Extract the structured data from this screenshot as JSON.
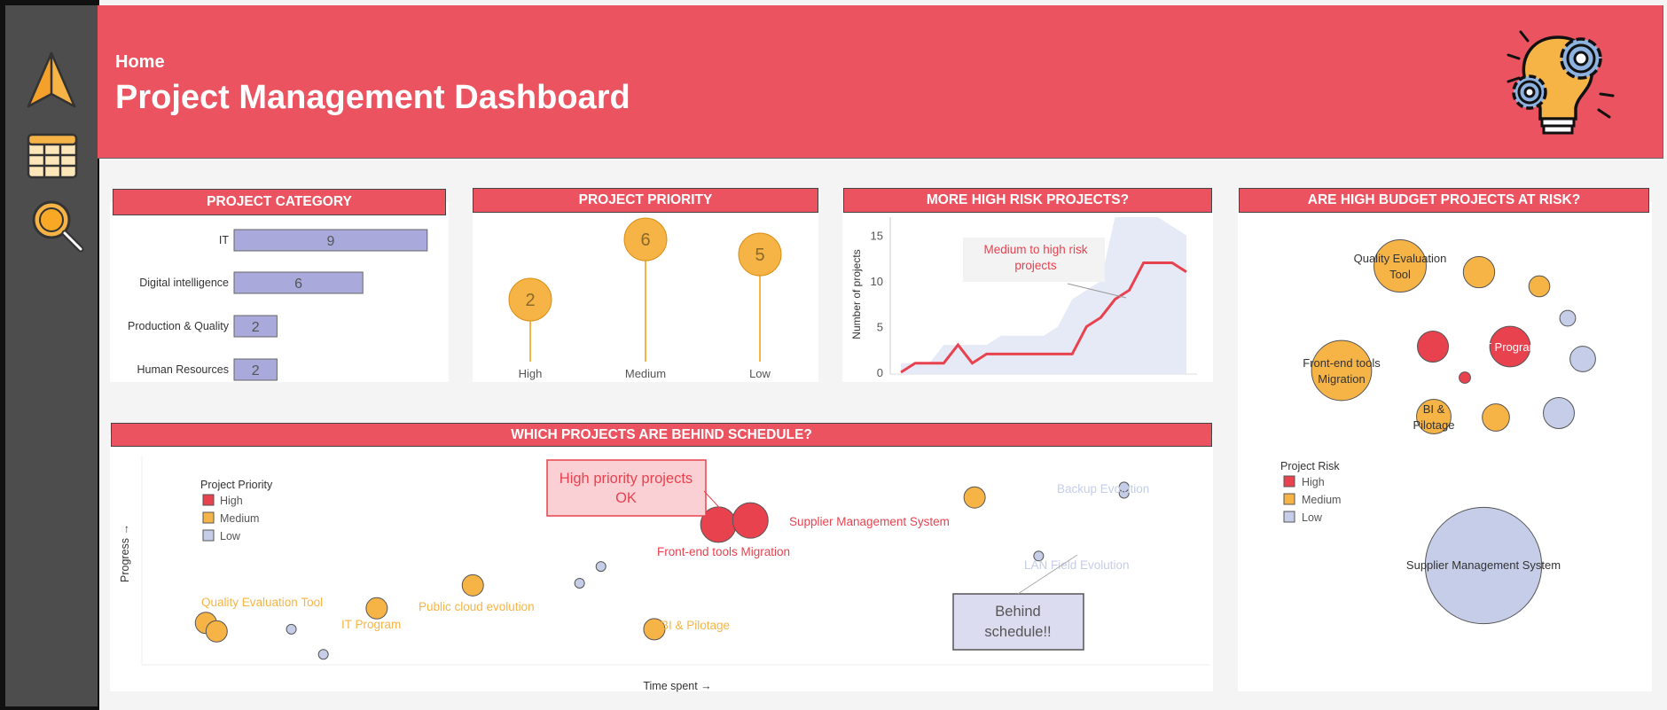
{
  "header": {
    "breadcrumb": "Home",
    "title": "Project Management Dashboard",
    "background": "#ea535f"
  },
  "sidebar": {
    "items": [
      {
        "icon": "navigation-arrow-icon"
      },
      {
        "icon": "table-grid-icon"
      },
      {
        "icon": "search-magnifier-icon"
      }
    ]
  },
  "colors": {
    "high": "#e8424f",
    "medium": "#f7b446",
    "low": "#c5cde8",
    "bar": "#a9aadb",
    "accent": "#ea535f"
  },
  "panels": {
    "category": {
      "title": "PROJECT CATEGORY",
      "chart_data": {
        "type": "bar",
        "categories": [
          "IT",
          "Digital intelligence",
          "Production & Quality",
          "Human Resources"
        ],
        "values": [
          9,
          6,
          2,
          2
        ]
      }
    },
    "priority": {
      "title": "PROJECT PRIORITY",
      "chart_data": {
        "type": "lollipop",
        "categories": [
          "High",
          "Medium",
          "Low"
        ],
        "values": [
          2,
          6,
          5
        ]
      }
    },
    "risk": {
      "title": "MORE HIGH RISK PROJECTS?",
      "annotation": "Medium to high risk projects",
      "ylabel": "Number of projects",
      "chart_data": {
        "type": "line",
        "ylim": [
          0,
          17
        ],
        "yticks": [
          0,
          5,
          10,
          15
        ],
        "series": [
          {
            "values": [
              0,
              1,
              1,
              1,
              3,
              1,
              2,
              2,
              2,
              2,
              2,
              2,
              2,
              5,
              6,
              8,
              9,
              12,
              12,
              12,
              11
            ],
            "color": "#e8424f"
          },
          {
            "values": [
              1,
              1,
              1,
              3,
              3,
              3,
              3,
              4,
              4,
              4,
              4,
              5,
              8,
              9,
              10,
              17,
              17,
              17,
              17,
              16,
              15
            ],
            "color": "#e6e9f6"
          }
        ]
      }
    },
    "budget": {
      "title": "ARE HIGH BUDGET PROJECTS AT RISK?",
      "legend_title": "Project Risk",
      "legend": [
        "High",
        "Medium",
        "Low"
      ],
      "labels": {
        "qe": "Quality Evaluation Tool",
        "fe": "Front-end tools Migration",
        "it": "IT Program",
        "bi": "BI & Pilotage",
        "sms": "Supplier Management System"
      },
      "chart_data": {
        "type": "bubble",
        "bubbles": [
          {
            "name": "Quality Evaluation Tool",
            "risk": "Medium",
            "size": 2730
          },
          {
            "name": "Front-end tools Migration",
            "risk": "Medium",
            "size": 3600
          },
          {
            "name": "IT Program",
            "risk": "High",
            "size": 1640
          },
          {
            "name": "BI & Pilotage",
            "risk": "Medium",
            "size": 1190
          },
          {
            "name": "Supplier Management System",
            "risk": "Low",
            "size": 13540
          },
          {
            "name": "",
            "risk": "Medium",
            "size": 980
          },
          {
            "name": "",
            "risk": "Medium",
            "size": 440
          },
          {
            "name": "",
            "risk": "Low",
            "size": 250
          },
          {
            "name": "",
            "risk": "Low",
            "size": 650
          },
          {
            "name": "",
            "risk": "High",
            "size": 960
          },
          {
            "name": "",
            "risk": "High",
            "size": 130
          },
          {
            "name": "",
            "risk": "Medium",
            "size": 740
          },
          {
            "name": "",
            "risk": "Low",
            "size": 960
          }
        ]
      }
    },
    "schedule": {
      "title": "WHICH PROJECTS ARE BEHIND SCHEDULE?",
      "legend_title": "Project Priority",
      "legend": [
        "High",
        "Medium",
        "Low"
      ],
      "xlabel": "Time spent →",
      "ylabel": "Progress →",
      "callout_high": "High priority projects OK",
      "callout_behind": "Behind schedule!!",
      "labels": {
        "qe": "Quality Evaluation Tool",
        "it": "IT Program",
        "pc": "Public cloud evolution",
        "bi": "BI & Pilotage",
        "fe": "Front-end tools Migration",
        "sms": "Supplier Management System",
        "backup": "Backup Evolution",
        "lan": "LAN Field Evolution"
      },
      "chart_data": {
        "type": "scatter",
        "points": [
          {
            "name": "Quality Evaluation Tool",
            "priority": "Medium",
            "x": 0.06,
            "y": 0.2
          },
          {
            "name": "",
            "priority": "Medium",
            "x": 0.07,
            "y": 0.16
          },
          {
            "name": "",
            "priority": "Low",
            "x": 0.14,
            "y": 0.17
          },
          {
            "name": "",
            "priority": "Low",
            "x": 0.17,
            "y": 0.05
          },
          {
            "name": "IT Program",
            "priority": "Medium",
            "x": 0.22,
            "y": 0.27
          },
          {
            "name": "Public cloud evolution",
            "priority": "Medium",
            "x": 0.31,
            "y": 0.38
          },
          {
            "name": "",
            "priority": "Low",
            "x": 0.41,
            "y": 0.39
          },
          {
            "name": "",
            "priority": "Low",
            "x": 0.43,
            "y": 0.47
          },
          {
            "name": "BI & Pilotage",
            "priority": "Medium",
            "x": 0.48,
            "y": 0.17
          },
          {
            "name": "Front-end tools Migration",
            "priority": "High",
            "x": 0.54,
            "y": 0.67
          },
          {
            "name": "Supplier Management System",
            "priority": "High",
            "x": 0.57,
            "y": 0.69
          },
          {
            "name": "",
            "priority": "Medium",
            "x": 0.78,
            "y": 0.8
          },
          {
            "name": "LAN Field Evolution",
            "priority": "Low",
            "x": 0.84,
            "y": 0.52
          },
          {
            "name": "Backup Evolution",
            "priority": "Low",
            "x": 0.92,
            "y": 0.82
          },
          {
            "name": "",
            "priority": "Low",
            "x": 0.92,
            "y": 0.85
          }
        ]
      }
    }
  }
}
